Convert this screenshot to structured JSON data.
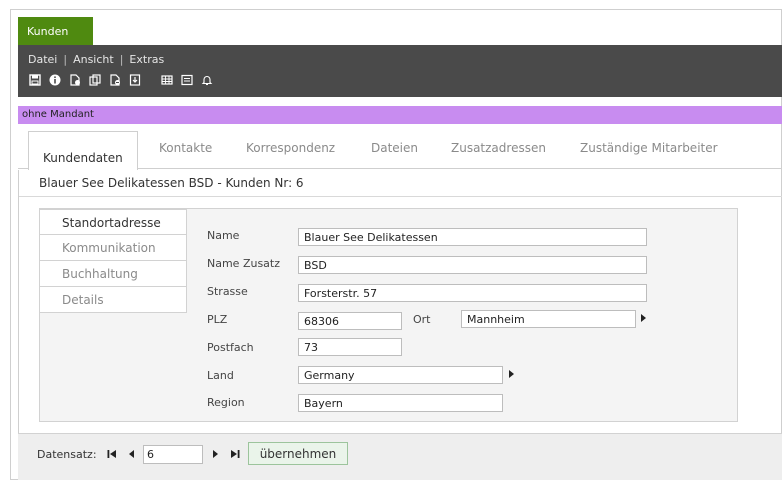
{
  "app": {
    "tab_label": "Kunden"
  },
  "menu": {
    "items": [
      "Datei",
      "Ansicht",
      "Extras"
    ],
    "separator": "|"
  },
  "toolbar_icons": [
    "save-icon",
    "info-icon",
    "new-document-icon",
    "copy-icon",
    "delete-document-icon",
    "export-icon",
    "table-icon",
    "form-icon",
    "bell-icon"
  ],
  "mandant": {
    "label": "ohne Mandant",
    "color": "#c88cf0"
  },
  "tabs": [
    {
      "label": "Kundendaten",
      "active": true
    },
    {
      "label": "Kontakte"
    },
    {
      "label": "Korrespondenz"
    },
    {
      "label": "Dateien"
    },
    {
      "label": "Zusatzadressen"
    },
    {
      "label": "Zuständige Mitarbeiter"
    }
  ],
  "customer": {
    "heading": "Blauer See Delikatessen BSD - Kunden Nr: 6"
  },
  "sidenav": [
    {
      "label": "Standortadresse",
      "active": true
    },
    {
      "label": "Kommunikation"
    },
    {
      "label": "Buchhaltung"
    },
    {
      "label": "Details"
    }
  ],
  "form": {
    "name_label": "Name",
    "name_value": "Blauer See Delikatessen",
    "name_zusatz_label": "Name Zusatz",
    "name_zusatz_value": "BSD",
    "strasse_label": "Strasse",
    "strasse_value": "Forsterstr. 57",
    "plz_label": "PLZ",
    "plz_value": "68306",
    "ort_label": "Ort",
    "ort_value": "Mannheim",
    "postfach_label": "Postfach",
    "postfach_value": "73",
    "land_label": "Land",
    "land_value": "Germany",
    "region_label": "Region",
    "region_value": "Bayern"
  },
  "footer": {
    "datensatz_label": "Datensatz:",
    "record_value": "6",
    "apply_label": "übernehmen"
  },
  "colors": {
    "accent_green": "#4f8a10",
    "toolbar_bg": "#4a4a4a"
  }
}
